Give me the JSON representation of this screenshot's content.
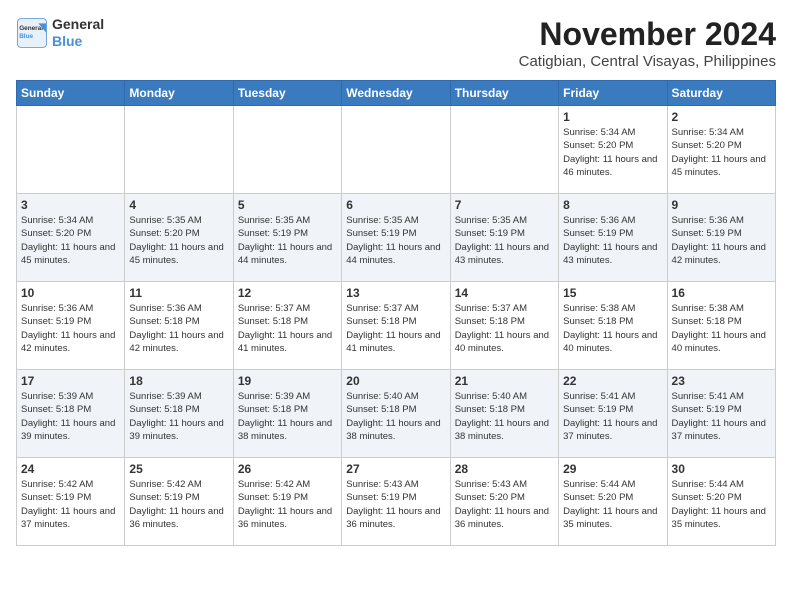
{
  "logo": {
    "line1": "General",
    "line2": "Blue"
  },
  "title": "November 2024",
  "subtitle": "Catigbian, Central Visayas, Philippines",
  "weekdays": [
    "Sunday",
    "Monday",
    "Tuesday",
    "Wednesday",
    "Thursday",
    "Friday",
    "Saturday"
  ],
  "weeks": [
    [
      {
        "day": "",
        "info": ""
      },
      {
        "day": "",
        "info": ""
      },
      {
        "day": "",
        "info": ""
      },
      {
        "day": "",
        "info": ""
      },
      {
        "day": "",
        "info": ""
      },
      {
        "day": "1",
        "info": "Sunrise: 5:34 AM\nSunset: 5:20 PM\nDaylight: 11 hours and 46 minutes."
      },
      {
        "day": "2",
        "info": "Sunrise: 5:34 AM\nSunset: 5:20 PM\nDaylight: 11 hours and 45 minutes."
      }
    ],
    [
      {
        "day": "3",
        "info": "Sunrise: 5:34 AM\nSunset: 5:20 PM\nDaylight: 11 hours and 45 minutes."
      },
      {
        "day": "4",
        "info": "Sunrise: 5:35 AM\nSunset: 5:20 PM\nDaylight: 11 hours and 45 minutes."
      },
      {
        "day": "5",
        "info": "Sunrise: 5:35 AM\nSunset: 5:19 PM\nDaylight: 11 hours and 44 minutes."
      },
      {
        "day": "6",
        "info": "Sunrise: 5:35 AM\nSunset: 5:19 PM\nDaylight: 11 hours and 44 minutes."
      },
      {
        "day": "7",
        "info": "Sunrise: 5:35 AM\nSunset: 5:19 PM\nDaylight: 11 hours and 43 minutes."
      },
      {
        "day": "8",
        "info": "Sunrise: 5:36 AM\nSunset: 5:19 PM\nDaylight: 11 hours and 43 minutes."
      },
      {
        "day": "9",
        "info": "Sunrise: 5:36 AM\nSunset: 5:19 PM\nDaylight: 11 hours and 42 minutes."
      }
    ],
    [
      {
        "day": "10",
        "info": "Sunrise: 5:36 AM\nSunset: 5:19 PM\nDaylight: 11 hours and 42 minutes."
      },
      {
        "day": "11",
        "info": "Sunrise: 5:36 AM\nSunset: 5:18 PM\nDaylight: 11 hours and 42 minutes."
      },
      {
        "day": "12",
        "info": "Sunrise: 5:37 AM\nSunset: 5:18 PM\nDaylight: 11 hours and 41 minutes."
      },
      {
        "day": "13",
        "info": "Sunrise: 5:37 AM\nSunset: 5:18 PM\nDaylight: 11 hours and 41 minutes."
      },
      {
        "day": "14",
        "info": "Sunrise: 5:37 AM\nSunset: 5:18 PM\nDaylight: 11 hours and 40 minutes."
      },
      {
        "day": "15",
        "info": "Sunrise: 5:38 AM\nSunset: 5:18 PM\nDaylight: 11 hours and 40 minutes."
      },
      {
        "day": "16",
        "info": "Sunrise: 5:38 AM\nSunset: 5:18 PM\nDaylight: 11 hours and 40 minutes."
      }
    ],
    [
      {
        "day": "17",
        "info": "Sunrise: 5:39 AM\nSunset: 5:18 PM\nDaylight: 11 hours and 39 minutes."
      },
      {
        "day": "18",
        "info": "Sunrise: 5:39 AM\nSunset: 5:18 PM\nDaylight: 11 hours and 39 minutes."
      },
      {
        "day": "19",
        "info": "Sunrise: 5:39 AM\nSunset: 5:18 PM\nDaylight: 11 hours and 38 minutes."
      },
      {
        "day": "20",
        "info": "Sunrise: 5:40 AM\nSunset: 5:18 PM\nDaylight: 11 hours and 38 minutes."
      },
      {
        "day": "21",
        "info": "Sunrise: 5:40 AM\nSunset: 5:18 PM\nDaylight: 11 hours and 38 minutes."
      },
      {
        "day": "22",
        "info": "Sunrise: 5:41 AM\nSunset: 5:19 PM\nDaylight: 11 hours and 37 minutes."
      },
      {
        "day": "23",
        "info": "Sunrise: 5:41 AM\nSunset: 5:19 PM\nDaylight: 11 hours and 37 minutes."
      }
    ],
    [
      {
        "day": "24",
        "info": "Sunrise: 5:42 AM\nSunset: 5:19 PM\nDaylight: 11 hours and 37 minutes."
      },
      {
        "day": "25",
        "info": "Sunrise: 5:42 AM\nSunset: 5:19 PM\nDaylight: 11 hours and 36 minutes."
      },
      {
        "day": "26",
        "info": "Sunrise: 5:42 AM\nSunset: 5:19 PM\nDaylight: 11 hours and 36 minutes."
      },
      {
        "day": "27",
        "info": "Sunrise: 5:43 AM\nSunset: 5:19 PM\nDaylight: 11 hours and 36 minutes."
      },
      {
        "day": "28",
        "info": "Sunrise: 5:43 AM\nSunset: 5:20 PM\nDaylight: 11 hours and 36 minutes."
      },
      {
        "day": "29",
        "info": "Sunrise: 5:44 AM\nSunset: 5:20 PM\nDaylight: 11 hours and 35 minutes."
      },
      {
        "day": "30",
        "info": "Sunrise: 5:44 AM\nSunset: 5:20 PM\nDaylight: 11 hours and 35 minutes."
      }
    ]
  ]
}
